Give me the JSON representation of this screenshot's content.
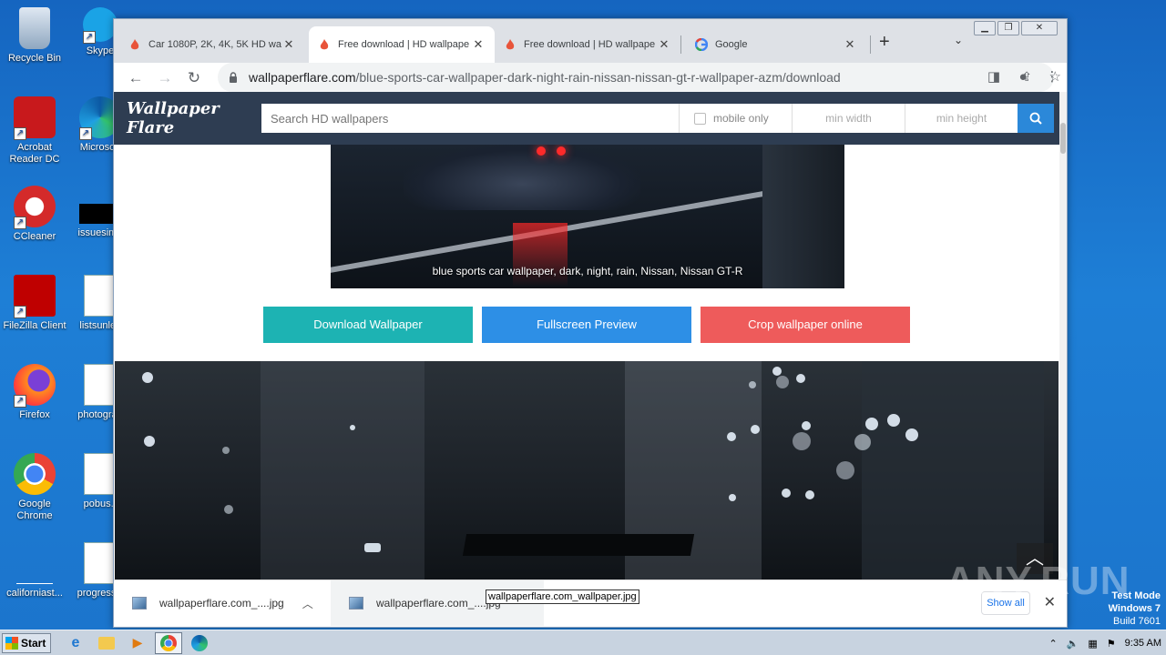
{
  "desktop": {
    "icons": [
      {
        "label": "Recycle Bin"
      },
      {
        "label": "Skype"
      },
      {
        "label": "Acrobat Reader DC"
      },
      {
        "label": "Microsoft"
      },
      {
        "label": "CCleaner"
      },
      {
        "label": "issuesimp"
      },
      {
        "label": "FileZilla Client"
      },
      {
        "label": "listsunles"
      },
      {
        "label": "Firefox"
      },
      {
        "label": "photograp"
      },
      {
        "label": "Google Chrome"
      },
      {
        "label": "pobus.r"
      },
      {
        "label": "californiast..."
      },
      {
        "label": "progressiv"
      }
    ]
  },
  "browser": {
    "tabs": [
      {
        "title": "Car 1080P, 2K, 4K, 5K HD wa",
        "icon": "flame-icon"
      },
      {
        "title": "Free download | HD wallpape",
        "icon": "flame-icon",
        "active": true
      },
      {
        "title": "Free download | HD wallpape",
        "icon": "flame-icon"
      },
      {
        "title": "Google",
        "icon": "google-icon"
      }
    ],
    "new_tab": "+",
    "url_host": "wallpaperflare.com",
    "url_path": "/blue-sports-car-wallpaper-dark-night-rain-nissan-nissan-gt-r-wallpaper-azm/download"
  },
  "site": {
    "logo": "Wallpaper Flare",
    "search_placeholder": "Search HD wallpapers",
    "mobile_only": "mobile only",
    "min_width": "min width",
    "min_height": "min height",
    "caption": "blue sports car wallpaper, dark, night, rain, Nissan, Nissan GT-R",
    "btn_download": "Download Wallpaper",
    "btn_fullscreen": "Fullscreen Preview",
    "btn_crop": "Crop wallpaper online",
    "colors": {
      "header": "#2e3d52",
      "download": "#1db3b3",
      "fullscreen": "#2d8fe6",
      "crop": "#ee5b5b"
    }
  },
  "downloads": {
    "items": [
      {
        "name": "wallpaperflare.com_....jpg"
      },
      {
        "name": "wallpaperflare.com_....jpg"
      }
    ],
    "tooltip": "wallpaperflare.com_wallpaper.jpg",
    "show_all": "Show all"
  },
  "watermark": {
    "brand": "ANY.RUN",
    "line1": "Test Mode",
    "line2": "Windows 7",
    "line3": "Build 7601"
  },
  "taskbar": {
    "start": "Start",
    "time": "9:35 AM"
  }
}
